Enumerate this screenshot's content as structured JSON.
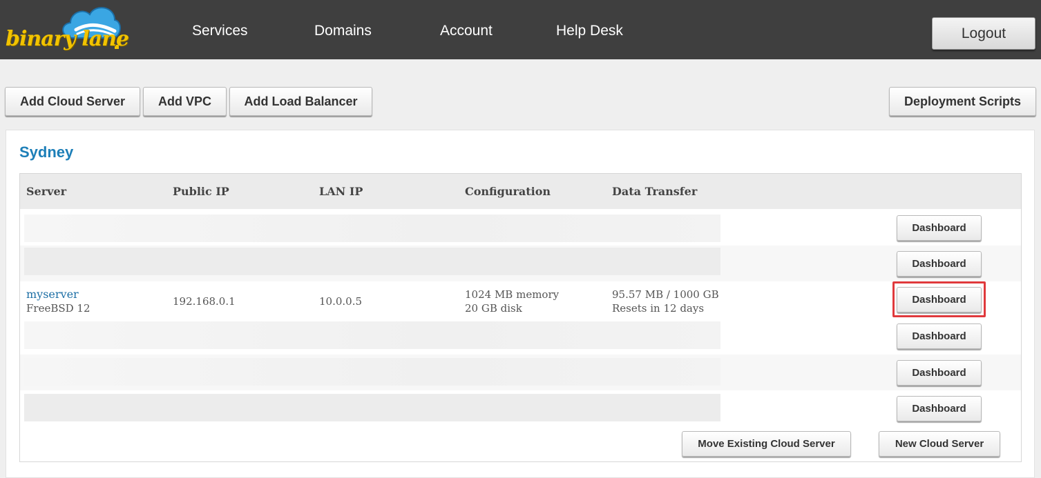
{
  "brand": {
    "logo_text": "binary lane"
  },
  "nav": {
    "services": "Services",
    "domains": "Domains",
    "account": "Account",
    "help_desk": "Help Desk",
    "logout": "Logout"
  },
  "toolbar": {
    "add_cloud_server": "Add Cloud Server",
    "add_vpc": "Add VPC",
    "add_load_balancer": "Add Load Balancer",
    "deployment_scripts": "Deployment Scripts"
  },
  "region": {
    "title": "Sydney",
    "columns": {
      "server": "Server",
      "public_ip": "Public IP",
      "lan_ip": "LAN IP",
      "configuration": "Configuration",
      "data_transfer": "Data Transfer"
    },
    "server": {
      "name": "myserver",
      "os": "FreeBSD 12",
      "public_ip": "192.168.0.1",
      "lan_ip": "10.0.0.5",
      "memory": "1024 MB memory",
      "disk": "20 GB disk",
      "transfer": "95.57 MB / 1000 GB",
      "resets": "Resets in 12 days"
    },
    "dashboard_label": "Dashboard",
    "move_existing": "Move Existing Cloud Server",
    "new_cloud_server": "New Cloud Server"
  },
  "colors": {
    "topbar": "#3f3f3f",
    "accent": "#1d7fb8",
    "logo": "#f2c300",
    "highlight": "#e0393c"
  }
}
